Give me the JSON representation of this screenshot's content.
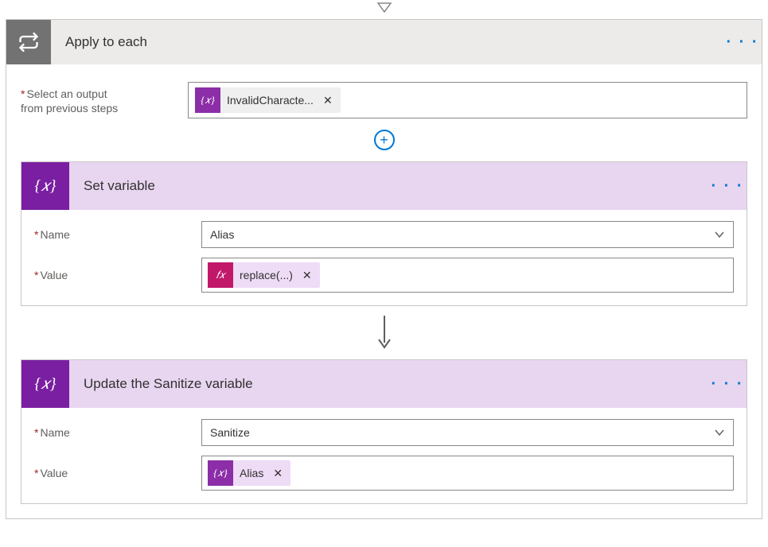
{
  "outer": {
    "title": "Apply to each",
    "select_label_l1": "Select an output",
    "select_label_l2": "from previous steps",
    "token_label": "InvalidCharacte..."
  },
  "step1": {
    "title": "Set variable",
    "name_label": "Name",
    "name_value": "Alias",
    "value_label": "Value",
    "value_token": "replace(...)"
  },
  "step2": {
    "title": "Update the Sanitize variable",
    "name_label": "Name",
    "name_value": "Sanitize",
    "value_label": "Value",
    "value_token": "Alias"
  },
  "glyphs": {
    "req": "*",
    "x": "✕",
    "plus": "+",
    "dots": "· · ·",
    "var": "{𝑥}",
    "fx": "𝑓𝑥"
  }
}
